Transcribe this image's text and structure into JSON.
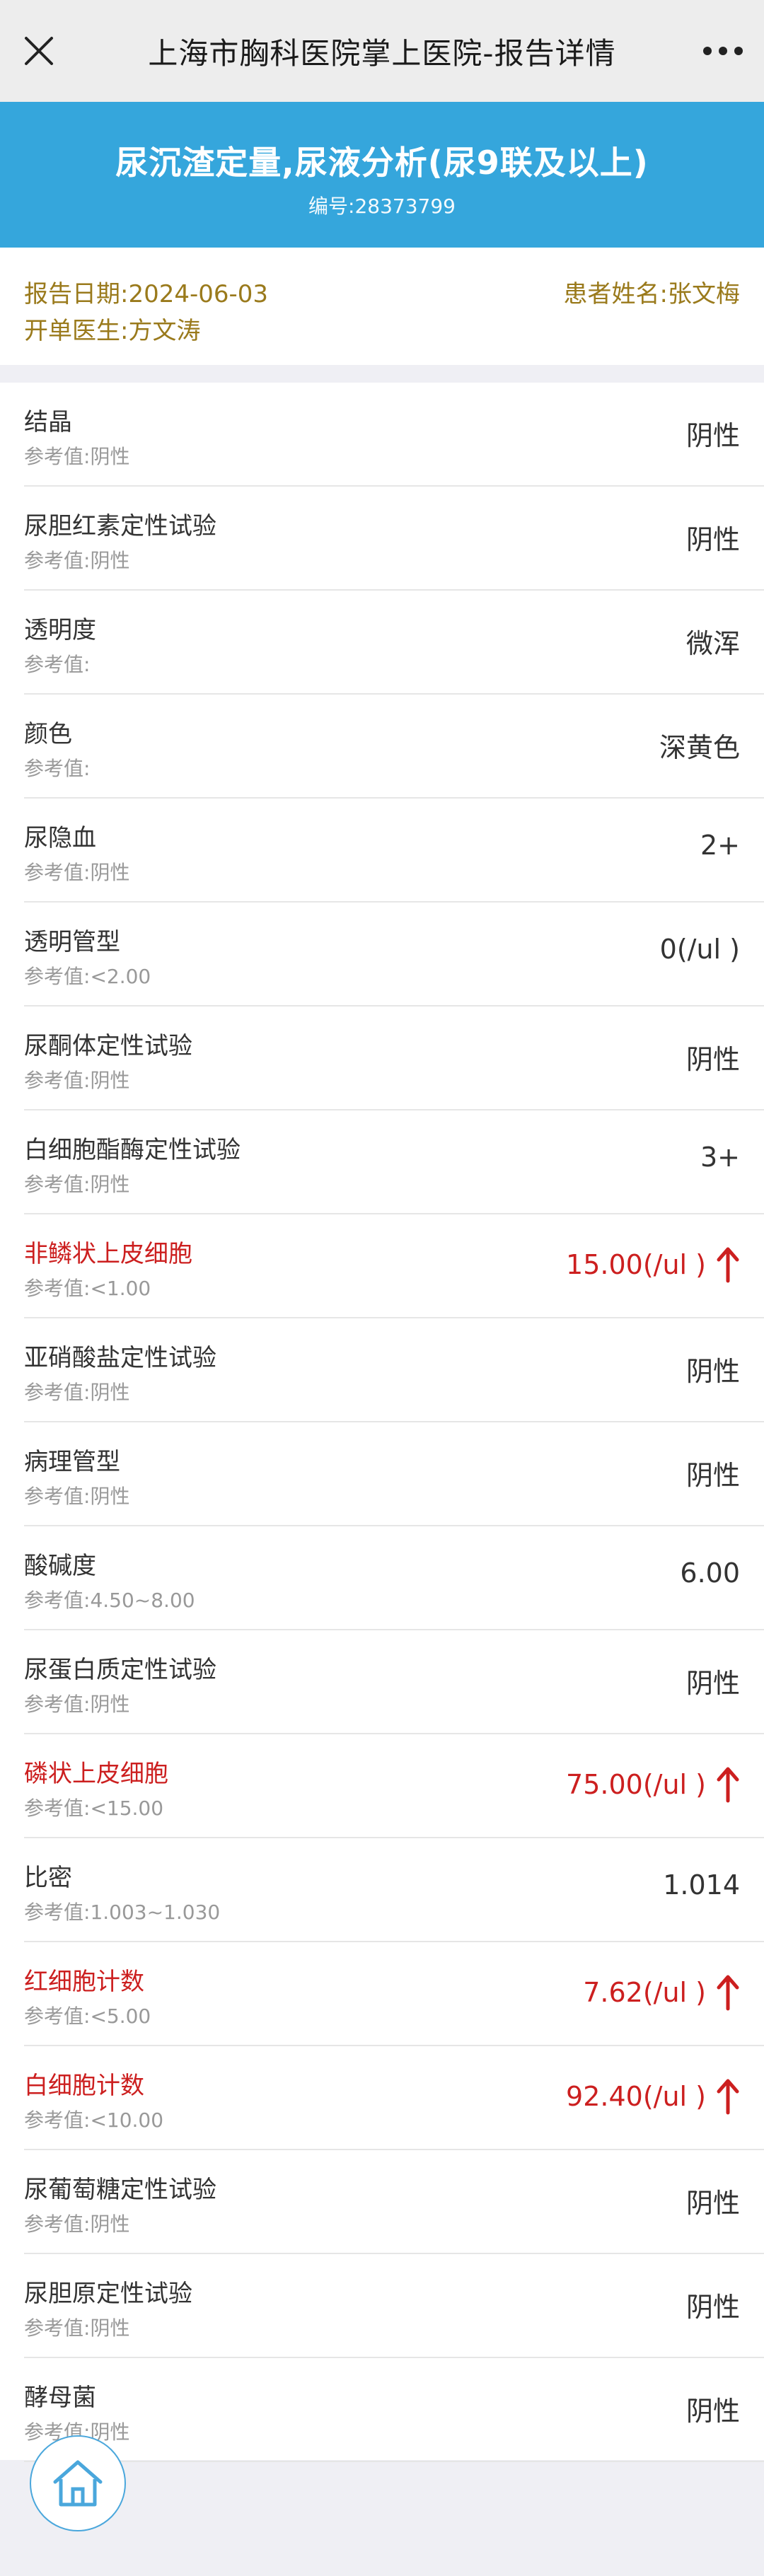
{
  "nav": {
    "title": "上海市胸科医院掌上医院-报告详情",
    "close_icon": "close-icon",
    "more_icon": "more-icon"
  },
  "report": {
    "title": "尿沉渣定量,尿液分析(尿9联及以上)",
    "code_label": "编号:",
    "code": "28373799"
  },
  "info": {
    "date_label": "报告日期:",
    "date": "2024-06-03",
    "patient_label": "患者姓名:",
    "patient": "张文梅",
    "doctor_label": "开单医生:",
    "doctor": "方文涛"
  },
  "ref_prefix": "参考值:",
  "items": [
    {
      "name": "结晶",
      "ref": "阴性",
      "value": "阴性",
      "abnormal": false
    },
    {
      "name": "尿胆红素定性试验",
      "ref": "阴性",
      "value": "阴性",
      "abnormal": false
    },
    {
      "name": "透明度",
      "ref": "",
      "value": "微浑",
      "abnormal": false
    },
    {
      "name": "颜色",
      "ref": "",
      "value": "深黄色",
      "abnormal": false
    },
    {
      "name": "尿隐血",
      "ref": "阴性",
      "value": "2+",
      "abnormal": false
    },
    {
      "name": "透明管型",
      "ref": "<2.00",
      "value": "0(/ul )",
      "abnormal": false
    },
    {
      "name": "尿酮体定性试验",
      "ref": "阴性",
      "value": "阴性",
      "abnormal": false
    },
    {
      "name": "白细胞酯酶定性试验",
      "ref": "阴性",
      "value": "3+",
      "abnormal": false
    },
    {
      "name": "非鳞状上皮细胞",
      "ref": "<1.00",
      "value": "15.00(/ul )",
      "abnormal": true
    },
    {
      "name": "亚硝酸盐定性试验",
      "ref": "阴性",
      "value": "阴性",
      "abnormal": false
    },
    {
      "name": "病理管型",
      "ref": "阴性",
      "value": "阴性",
      "abnormal": false
    },
    {
      "name": "酸碱度",
      "ref": "4.50~8.00",
      "value": "6.00",
      "abnormal": false
    },
    {
      "name": "尿蛋白质定性试验",
      "ref": "阴性",
      "value": "阴性",
      "abnormal": false
    },
    {
      "name": "磷状上皮细胞",
      "ref": "<15.00",
      "value": "75.00(/ul )",
      "abnormal": true
    },
    {
      "name": "比密",
      "ref": "1.003~1.030",
      "value": "1.014",
      "abnormal": false
    },
    {
      "name": "红细胞计数",
      "ref": "<5.00",
      "value": "7.62(/ul )",
      "abnormal": true
    },
    {
      "name": "白细胞计数",
      "ref": "<10.00",
      "value": "92.40(/ul )",
      "abnormal": true
    },
    {
      "name": "尿葡萄糖定性试验",
      "ref": "阴性",
      "value": "阴性",
      "abnormal": false
    },
    {
      "name": "尿胆原定性试验",
      "ref": "阴性",
      "value": "阴性",
      "abnormal": false
    },
    {
      "name": "酵母菌",
      "ref": "阴性",
      "value": "阴性",
      "abnormal": false
    }
  ],
  "colors": {
    "accent": "#35a6dc",
    "abnormal": "#cc1f1f",
    "info_text": "#9a7a1c"
  },
  "home_icon": "home-icon"
}
